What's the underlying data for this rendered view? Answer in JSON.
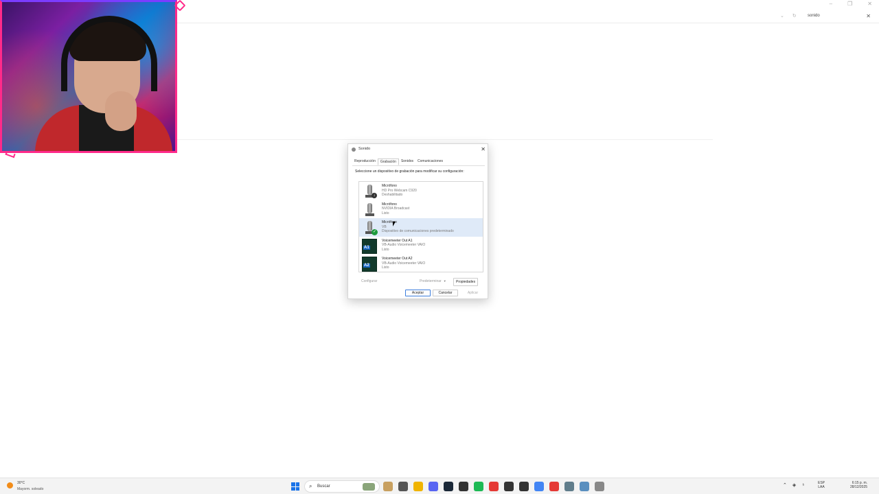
{
  "explorer": {
    "search_value": "sonido",
    "window_controls": [
      "–",
      "❐",
      "✕"
    ]
  },
  "sound_dialog": {
    "title": "Sonido",
    "tabs": [
      "Reproducción",
      "Grabación",
      "Sonidos",
      "Comunicaciones"
    ],
    "active_tab": "Grabación",
    "instructions": "Seleccione un dispositivo de grabación para modificar su configuración:",
    "devices": [
      {
        "name": "Micrófono",
        "description": "HD Pro Webcam C920",
        "status": "Deshabilitado",
        "icon": "microphone-icon",
        "badge": "disabled"
      },
      {
        "name": "Micrófono",
        "description": "NVIDIA Broadcast",
        "status": "Listo",
        "icon": "microphone-icon",
        "badge": "none"
      },
      {
        "name": "Micrófono",
        "description": "VB",
        "status": "Dispositivo de comunicaciones predeterminado",
        "icon": "microphone-icon",
        "badge": "default",
        "selected": true
      },
      {
        "name": "Voicemeeter Out A1",
        "description": "VB-Audio Voicemeeter VAIO",
        "status": "Listo",
        "icon": "voicemeeter-icon",
        "icon_label": "A1"
      },
      {
        "name": "Voicemeeter Out A2",
        "description": "VB-Audio Voicemeeter VAIO",
        "status": "Listo",
        "icon": "voicemeeter-icon",
        "icon_label": "A2"
      }
    ],
    "buttons": {
      "configure": "Configurar",
      "set_default": "Predeterminar",
      "properties": "Propiedades",
      "ok": "Aceptar",
      "cancel": "Cancelar",
      "apply": "Aplicar"
    }
  },
  "taskbar": {
    "weather_temp": "30°C",
    "weather_condition": "Mayorm. soleado",
    "search_placeholder": "Buscar",
    "language": "ESP",
    "layout": "LAA",
    "time": "6:15 p. m.",
    "date": "28/12/2025",
    "app_colors": [
      "#c8a060",
      "#555555",
      "#f0b400",
      "#5865f2",
      "#1b2838",
      "#333333",
      "#1db954",
      "#e53935",
      "#333333",
      "#333333",
      "#4285f4",
      "#e53935",
      "#607d8b",
      "#5a8fbf",
      "#888888"
    ]
  },
  "colors": {
    "webcam_frame": "#ff2a8a",
    "selected_row": "#dfeaf8",
    "default_badge": "#1d9b3c",
    "windows_blue": "#1a73e8"
  }
}
